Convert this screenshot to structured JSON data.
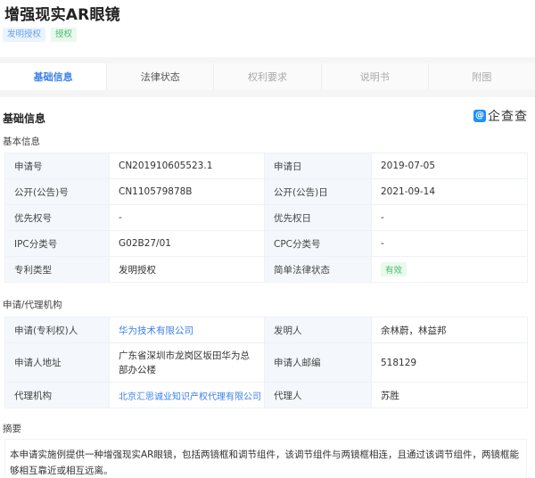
{
  "header": {
    "title": "增强现实AR眼镜",
    "tags": [
      {
        "label": "发明授权",
        "color": "#6aa0e8"
      },
      {
        "label": "授权",
        "color": "#4cba6d"
      }
    ]
  },
  "tabs": [
    {
      "label": "基础信息",
      "active": true
    },
    {
      "label": "法律状态",
      "active": false
    },
    {
      "label": "权利要求",
      "active": false
    },
    {
      "label": "说明书",
      "active": false
    },
    {
      "label": "附图",
      "active": false
    }
  ],
  "section": {
    "title": "基础信息",
    "logo": {
      "icon": "qcc-logo-icon",
      "text": "企查查",
      "color": "#1e90ff"
    }
  },
  "basic_info": {
    "heading": "基本信息",
    "rows": [
      [
        {
          "label": "申请号",
          "value": "CN201910605523.1"
        },
        {
          "label": "申请日",
          "value": "2019-07-05"
        }
      ],
      [
        {
          "label": "公开(公告)号",
          "value": "CN110579878B"
        },
        {
          "label": "公开(公告)日",
          "value": "2021-09-14"
        }
      ],
      [
        {
          "label": "优先权号",
          "value": "-"
        },
        {
          "label": "优先权日",
          "value": "-"
        }
      ],
      [
        {
          "label": "IPC分类号",
          "value": "G02B27/01"
        },
        {
          "label": "CPC分类号",
          "value": "-"
        }
      ],
      [
        {
          "label": "专利类型",
          "value": "发明授权"
        },
        {
          "label": "简单法律状态",
          "value": "有效"
        }
      ]
    ]
  },
  "agency": {
    "heading": "申请/代理机构",
    "rows": [
      [
        {
          "label": "申请(专利权)人",
          "value": "华为技术有限公司"
        },
        {
          "label": "发明人",
          "value": "余林蔚，林益邦"
        }
      ],
      [
        {
          "label": "申请人地址",
          "value": "广东省深圳市龙岗区坂田华为总部办公楼"
        },
        {
          "label": "申请人邮编",
          "value": "518129"
        }
      ],
      [
        {
          "label": "代理机构",
          "value": "北京汇思诚业知识产权代理有限公司"
        },
        {
          "label": "代理人",
          "value": "苏胜"
        }
      ]
    ]
  },
  "abstract": {
    "heading": "摘要",
    "text": "本申请实施例提供一种增强现实AR眼镜，包括两镜框和调节组件，该调节组件与两镜框相连，且通过该调节组件，两镜框能够相互靠近或相互远离。"
  }
}
